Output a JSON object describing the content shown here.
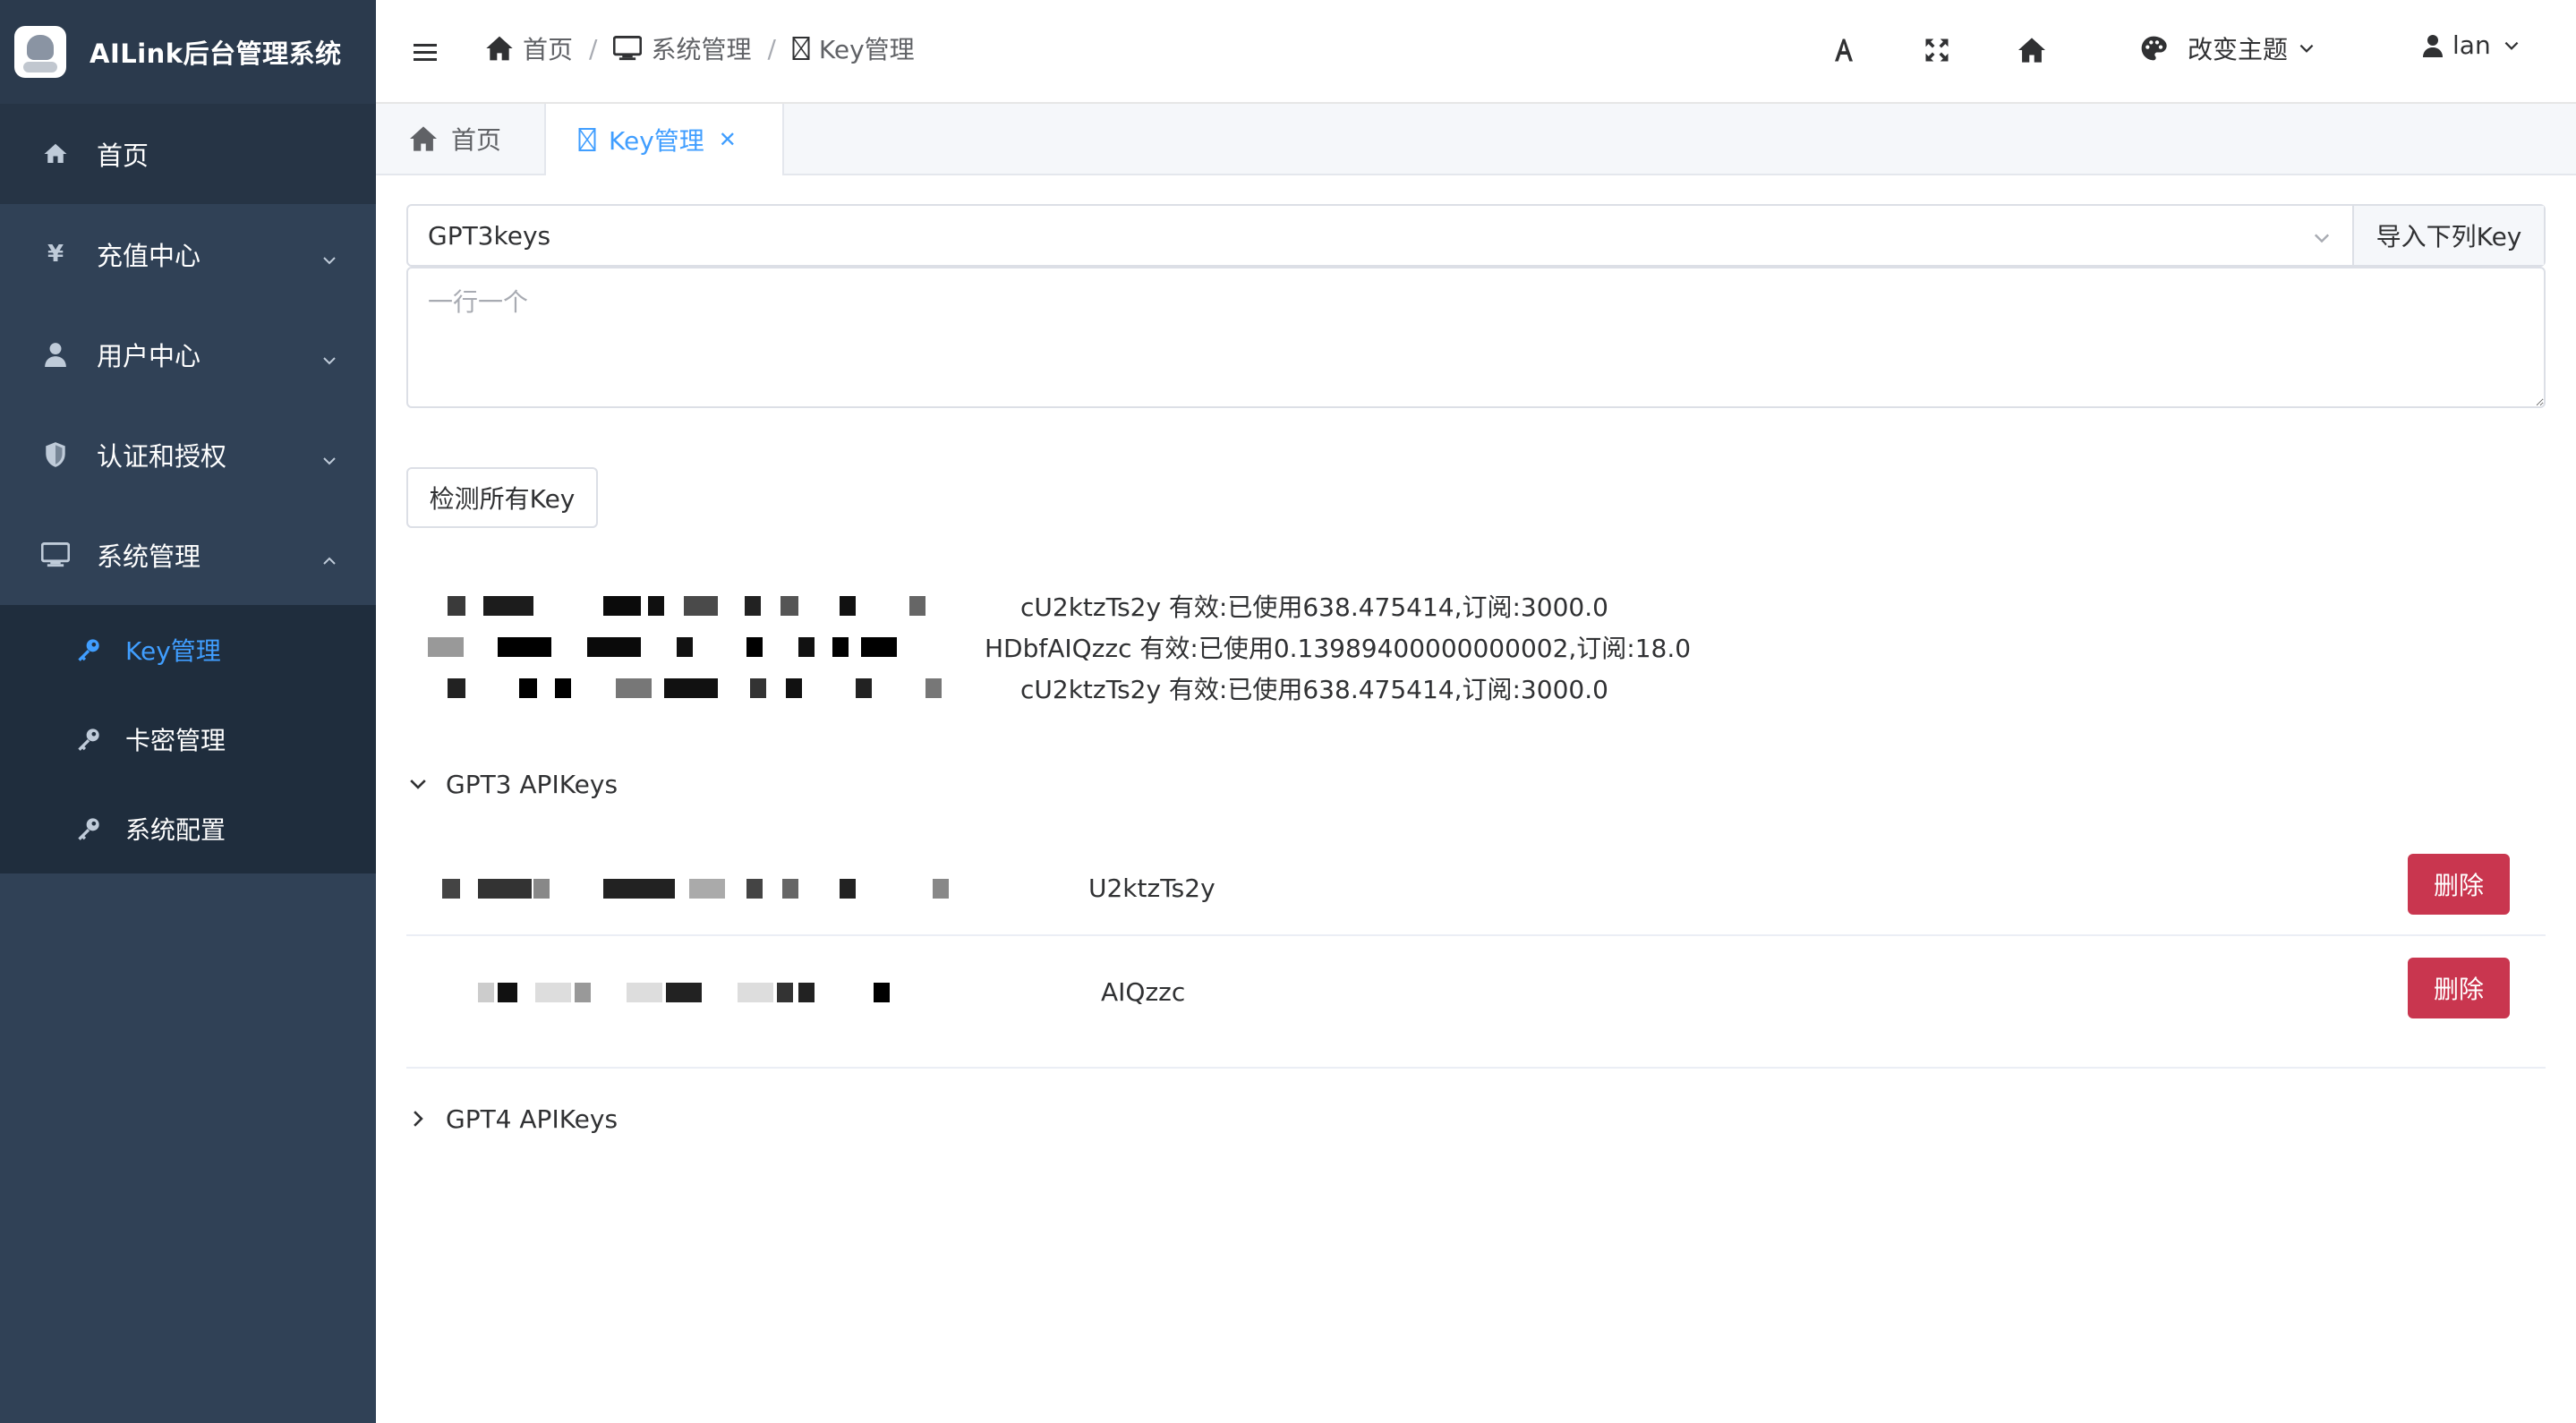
{
  "app": {
    "title": "AILink后台管理系统"
  },
  "sidebar": {
    "items": [
      {
        "label": "首页",
        "icon": "home-icon"
      },
      {
        "label": "充值中心",
        "icon": "yen-icon"
      },
      {
        "label": "用户中心",
        "icon": "user-icon"
      },
      {
        "label": "认证和授权",
        "icon": "shield-icon"
      },
      {
        "label": "系统管理",
        "icon": "monitor-icon"
      }
    ],
    "subitems": [
      {
        "label": "Key管理",
        "icon": "key-icon"
      },
      {
        "label": "卡密管理",
        "icon": "key-icon"
      },
      {
        "label": "系统配置",
        "icon": "key-icon"
      }
    ]
  },
  "breadcrumb": [
    "首页",
    "系统管理",
    "Key管理"
  ],
  "navbar": {
    "theme_label": "改变主题",
    "user_label": "lan"
  },
  "tags": {
    "home": "首页",
    "active": "Key管理"
  },
  "form": {
    "select_value": "GPT3keys",
    "import_label": "导入下列Key",
    "textarea_placeholder": "一行一个",
    "check_label": "检测所有Key"
  },
  "results": [
    "cU2ktzTs2y 有效:已使用638.475414,订阅:3000.0",
    "HDbfAIQzzc 有效:已使用0.13989400000000002,订阅:18.0",
    "cU2ktzTs2y 有效:已使用638.475414,订阅:3000.0"
  ],
  "gpt3": {
    "title": "GPT3 APIKeys",
    "keys": [
      {
        "suffix": "U2ktzTs2y",
        "delete_label": "删除"
      },
      {
        "suffix": "AIQzzc",
        "delete_label": "删除"
      }
    ]
  },
  "gpt4": {
    "title": "GPT4 APIKeys"
  },
  "colors": {
    "sidebar": "#304156",
    "accent": "#409eff",
    "danger": "#c9364f"
  }
}
